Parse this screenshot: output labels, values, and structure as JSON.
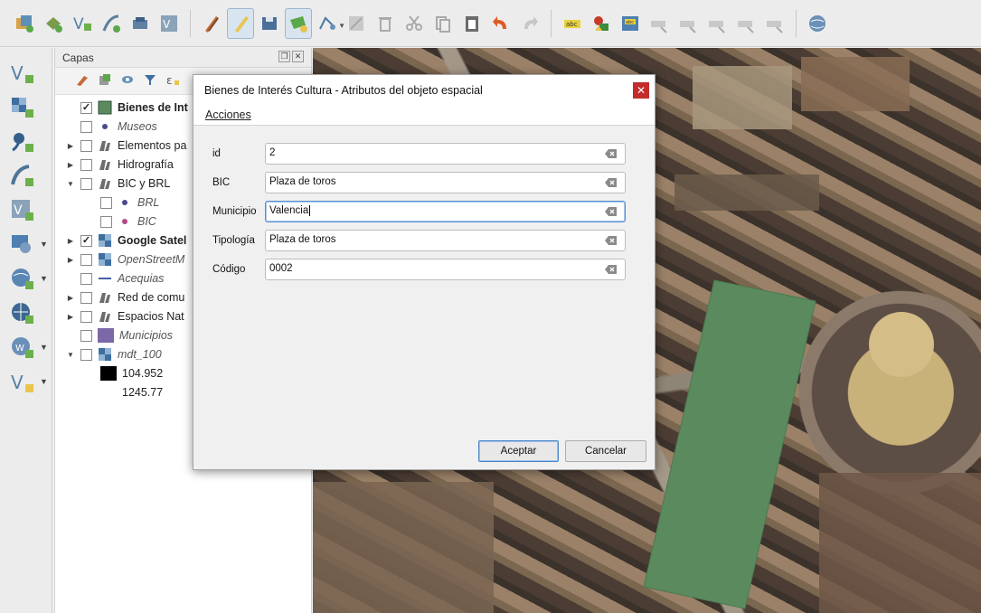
{
  "toolbar": {
    "icons": [
      "layers-db-icon",
      "layers-manager-icon",
      "new-vector-layer-icon",
      "digitize-icon",
      "save-icon",
      "vector-icon",
      "pencil-icon",
      "toggle-edit-icon",
      "save-edits-icon",
      "add-feature-icon",
      "node-tool-icon",
      "modify-attributes-icon",
      "delete-icon",
      "cut-icon",
      "copy-icon",
      "paste-icon",
      "undo-icon",
      "redo-icon",
      "label-icon",
      "label-pin-icon",
      "label-style-icon",
      "label-move-icon",
      "label-rotate-icon",
      "label-change-icon",
      "label-show-icon",
      "label-hide-icon",
      "globe-icon"
    ]
  },
  "vtoolbar": {
    "icons": [
      "add-vector-icon",
      "add-raster-icon",
      "add-point-icon",
      "add-line-icon",
      "add-polygon-icon",
      "add-wms-icon",
      "add-wfs-icon",
      "add-wcs-icon",
      "add-wms-globe-icon",
      "add-vector-dropdown-icon"
    ]
  },
  "layers_panel": {
    "title": "Capas",
    "layers": [
      {
        "label": "Bienes de Int",
        "checked": true,
        "style": "bold"
      },
      {
        "label": "Museos",
        "checked": false,
        "style": "italic"
      },
      {
        "label": "Elementos pa",
        "checked": false,
        "style": "normal"
      },
      {
        "label": "Hidrografía",
        "checked": false,
        "style": "normal"
      },
      {
        "label": "BIC y BRL",
        "checked": false,
        "style": "normal"
      },
      {
        "label": "BRL",
        "checked": false,
        "style": "italic"
      },
      {
        "label": "BIC",
        "checked": false,
        "style": "italic"
      },
      {
        "label": "Google Satel",
        "checked": true,
        "style": "bold"
      },
      {
        "label": "OpenStreetM",
        "checked": false,
        "style": "italic"
      },
      {
        "label": "Acequias",
        "checked": false,
        "style": "italic"
      },
      {
        "label": "Red de comu",
        "checked": false,
        "style": "normal"
      },
      {
        "label": "Espacios Nat",
        "checked": false,
        "style": "normal"
      },
      {
        "label": "Municipios",
        "checked": false,
        "style": "italic"
      },
      {
        "label": "mdt_100",
        "checked": false,
        "style": "italic"
      },
      {
        "label": "104.952",
        "style": "normal"
      },
      {
        "label": "1245.77",
        "style": "normal"
      }
    ]
  },
  "dialog": {
    "title": "Bienes de Interés Cultura - Atributos del objeto espacial",
    "menu_label": "Acciones",
    "fields": [
      {
        "label": "id",
        "value": "2"
      },
      {
        "label": "BIC",
        "value": "Plaza de toros"
      },
      {
        "label": "Municipio",
        "value": "Valencia"
      },
      {
        "label": "Tipología",
        "value": "Plaza de toros"
      },
      {
        "label": "Código",
        "value": "0002"
      }
    ],
    "ok_label": "Aceptar",
    "cancel_label": "Cancelar"
  },
  "colors": {
    "selected_feature": "#5a8a5e",
    "municipios_swatch": "#7b68a6",
    "close_button": "#c42b2b",
    "focus_border": "#5b8fd1"
  }
}
